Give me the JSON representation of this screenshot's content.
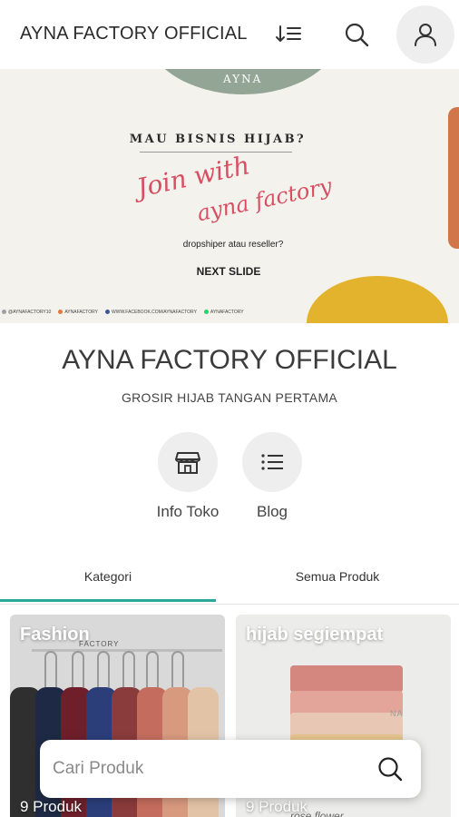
{
  "app_bar": {
    "title": "AYNA FACTORY OFFICIAL",
    "icons": [
      "sort-icon",
      "search-icon",
      "account-icon"
    ]
  },
  "banner": {
    "brand": "AYNA",
    "headline": "MAU BISNIS HIJAB?",
    "script_line1": "Join with",
    "script_line2": "ayna factory",
    "subtitle": "dropshiper atau reseller?",
    "next": "NEXT SLIDE",
    "social": [
      {
        "label": "@AYNAFACTORY10",
        "color": "#9aa0a6"
      },
      {
        "label": "AYNAFACTORY",
        "color": "#e4783c"
      },
      {
        "label": "WWW.FACEBOOK.COM/AYNAFACTORY",
        "color": "#3b5998"
      },
      {
        "label": "AYNAFACTORY",
        "color": "#25d366"
      }
    ]
  },
  "store": {
    "name": "AYNA FACTORY OFFICIAL",
    "tagline": "GROSIR HIJAB TANGAN PERTAMA",
    "actions": [
      {
        "label": "Info Toko",
        "icon": "store-icon"
      },
      {
        "label": "Blog",
        "icon": "list-icon"
      }
    ]
  },
  "tabs": [
    {
      "label": "Kategori",
      "active": true
    },
    {
      "label": "Semua Produk",
      "active": false
    }
  ],
  "categories": [
    {
      "name": "Fashion",
      "count": "9 Produk",
      "watermark": "FACTORY"
    },
    {
      "name": "hijab segiempat",
      "count": "9 Produk",
      "watermark": "NA",
      "caption": "rose flower"
    }
  ],
  "search": {
    "placeholder": "Cari Produk"
  },
  "colors": {
    "accent": "#2aa89a",
    "banner_bg": "#f4f2ec",
    "script_pink": "#d84f63",
    "blob_green": "#93a594",
    "blob_yellow": "#e3b32d",
    "bar_orange": "#d1764b"
  }
}
